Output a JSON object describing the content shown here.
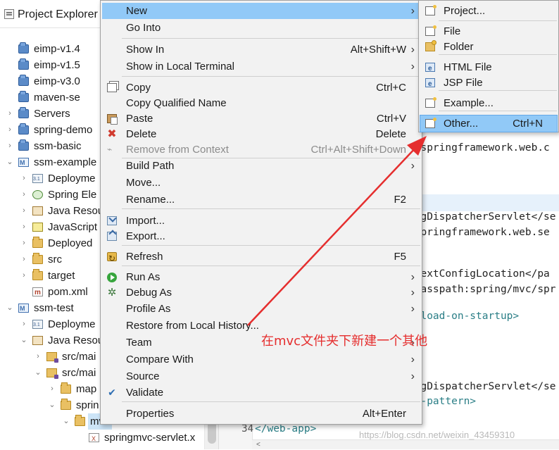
{
  "explorer": {
    "title": "Project Explorer",
    "items": [
      {
        "label": "eimp-v1.4",
        "icon": "project-folder-icon",
        "arrow": ""
      },
      {
        "label": "eimp-v1.5",
        "icon": "project-folder-icon",
        "arrow": ""
      },
      {
        "label": "eimp-v3.0",
        "icon": "project-folder-icon",
        "arrow": ""
      },
      {
        "label": "maven-se",
        "icon": "project-folder-icon",
        "arrow": ""
      },
      {
        "label": "Servers",
        "icon": "servers-folder-icon",
        "arrow": "›"
      },
      {
        "label": "spring-demo",
        "icon": "project-folder-icon",
        "arrow": "›"
      },
      {
        "label": "ssm-basic",
        "icon": "project-folder-icon",
        "arrow": "›"
      },
      {
        "label": "ssm-example",
        "icon": "jee-project-icon",
        "arrow": "⌄"
      },
      {
        "label": "Deployme",
        "icon": "deployment-descriptor-icon",
        "arrow": "›"
      },
      {
        "label": "Spring Ele",
        "icon": "spring-elements-icon",
        "arrow": "›"
      },
      {
        "label": "Java Resou",
        "icon": "java-resources-icon",
        "arrow": "›"
      },
      {
        "label": "JavaScript",
        "icon": "javascript-resources-icon",
        "arrow": "›"
      },
      {
        "label": "Deployed",
        "icon": "folder-icon",
        "arrow": "›"
      },
      {
        "label": "src",
        "icon": "folder-icon",
        "arrow": "›"
      },
      {
        "label": "target",
        "icon": "folder-icon",
        "arrow": "›"
      },
      {
        "label": "pom.xml",
        "icon": "maven-pom-icon",
        "arrow": ""
      },
      {
        "label": "ssm-test",
        "icon": "jee-project-icon",
        "arrow": "⌄"
      },
      {
        "label": "Deployme",
        "icon": "deployment-descriptor-icon",
        "arrow": "›"
      },
      {
        "label": "Java Resou",
        "icon": "java-resources-icon",
        "arrow": "⌄"
      },
      {
        "label": "src/mai",
        "icon": "source-folder-icon",
        "arrow": "›"
      },
      {
        "label": "src/mai",
        "icon": "source-folder-icon",
        "arrow": "⌄"
      },
      {
        "label": "map",
        "icon": "folder-icon",
        "arrow": "›"
      },
      {
        "label": "sprin",
        "icon": "folder-icon",
        "arrow": "⌄"
      },
      {
        "label": "mvc",
        "icon": "folder-icon",
        "arrow": "⌄"
      },
      {
        "label": "springmvc-servlet.x",
        "icon": "xml-file-icon",
        "arrow": ""
      }
    ]
  },
  "editor": {
    "code_lines": [
      {
        "text": "g.springframework.web.c",
        "kind": "plain"
      },
      {
        "text": "ingDispatcherServlet</se",
        "kind": "tagged"
      },
      {
        "text": ".springframework.web.se",
        "kind": "plain"
      },
      {
        "text": "ntextConfigLocation</pa",
        "kind": "tagged"
      },
      {
        "text": "classpath:spring/mvc/spr",
        "kind": "plain"
      },
      {
        "text": "</load-on-startup>",
        "kind": "tag"
      },
      {
        "text": "ingDispatcherServlet</se",
        "kind": "tagged"
      },
      {
        "text": "rl-pattern>",
        "kind": "tag"
      }
    ],
    "line_number": "34",
    "line_34": "</web-app>",
    "scroll_left_arrow": "<",
    "watermark": "https://blog.csdn.net/weixin_43459310"
  },
  "context_menu": {
    "items": [
      {
        "label": "New",
        "shortcut": "",
        "submenu": true,
        "icon": "",
        "disabled": false
      },
      {
        "label": "Go Into",
        "shortcut": "",
        "submenu": false,
        "icon": "",
        "disabled": false
      },
      {
        "label": "Show In",
        "shortcut": "Alt+Shift+W",
        "submenu": true,
        "icon": "",
        "disabled": false
      },
      {
        "label": "Show in Local Terminal",
        "shortcut": "",
        "submenu": true,
        "icon": "",
        "disabled": false
      },
      {
        "label": "Copy",
        "shortcut": "Ctrl+C",
        "submenu": false,
        "icon": "copy-icon",
        "disabled": false
      },
      {
        "label": "Copy Qualified Name",
        "shortcut": "",
        "submenu": false,
        "icon": "",
        "disabled": false
      },
      {
        "label": "Paste",
        "shortcut": "Ctrl+V",
        "submenu": false,
        "icon": "paste-icon",
        "disabled": false
      },
      {
        "label": "Delete",
        "shortcut": "Delete",
        "submenu": false,
        "icon": "delete-icon",
        "disabled": false
      },
      {
        "label": "Remove from Context",
        "shortcut": "Ctrl+Alt+Shift+Down",
        "submenu": false,
        "icon": "remove-context-icon",
        "disabled": true
      },
      {
        "label": "Build Path",
        "shortcut": "",
        "submenu": true,
        "icon": "",
        "disabled": false
      },
      {
        "label": "Move...",
        "shortcut": "",
        "submenu": false,
        "icon": "",
        "disabled": false
      },
      {
        "label": "Rename...",
        "shortcut": "F2",
        "submenu": false,
        "icon": "",
        "disabled": false
      },
      {
        "label": "Import...",
        "shortcut": "",
        "submenu": false,
        "icon": "import-icon",
        "disabled": false
      },
      {
        "label": "Export...",
        "shortcut": "",
        "submenu": false,
        "icon": "export-icon",
        "disabled": false
      },
      {
        "label": "Refresh",
        "shortcut": "F5",
        "submenu": false,
        "icon": "refresh-icon",
        "disabled": false
      },
      {
        "label": "Run As",
        "shortcut": "",
        "submenu": true,
        "icon": "run-icon",
        "disabled": false
      },
      {
        "label": "Debug As",
        "shortcut": "",
        "submenu": true,
        "icon": "debug-icon",
        "disabled": false
      },
      {
        "label": "Profile As",
        "shortcut": "",
        "submenu": true,
        "icon": "",
        "disabled": false
      },
      {
        "label": "Restore from Local History...",
        "shortcut": "",
        "submenu": false,
        "icon": "",
        "disabled": false
      },
      {
        "label": "Team",
        "shortcut": "",
        "submenu": true,
        "icon": "",
        "disabled": false
      },
      {
        "label": "Compare With",
        "shortcut": "",
        "submenu": true,
        "icon": "",
        "disabled": false
      },
      {
        "label": "Source",
        "shortcut": "",
        "submenu": true,
        "icon": "",
        "disabled": false
      },
      {
        "label": "Validate",
        "shortcut": "",
        "submenu": false,
        "icon": "validate-icon",
        "disabled": false
      },
      {
        "label": "Properties",
        "shortcut": "Alt+Enter",
        "submenu": false,
        "icon": "",
        "disabled": false
      }
    ]
  },
  "new_submenu": {
    "items": [
      {
        "label": "Project...",
        "shortcut": "",
        "icon": "new-project-icon"
      },
      {
        "label": "File",
        "shortcut": "",
        "icon": "new-file-icon"
      },
      {
        "label": "Folder",
        "shortcut": "",
        "icon": "new-folder-icon"
      },
      {
        "label": "HTML File",
        "shortcut": "",
        "icon": "html-file-icon"
      },
      {
        "label": "JSP File",
        "shortcut": "",
        "icon": "jsp-file-icon"
      },
      {
        "label": "Example...",
        "shortcut": "",
        "icon": "example-icon"
      },
      {
        "label": "Other...",
        "shortcut": "Ctrl+N",
        "icon": "other-icon"
      }
    ]
  },
  "annotation": {
    "text": "在mvc文件夹下新建一个其他",
    "color": "#e52e2e"
  },
  "colors": {
    "menu_highlight": "#91c9f7",
    "menu_background": "#f2f2f2",
    "annotation_red": "#e52e2e",
    "xml_tag": "#2a7e86"
  }
}
